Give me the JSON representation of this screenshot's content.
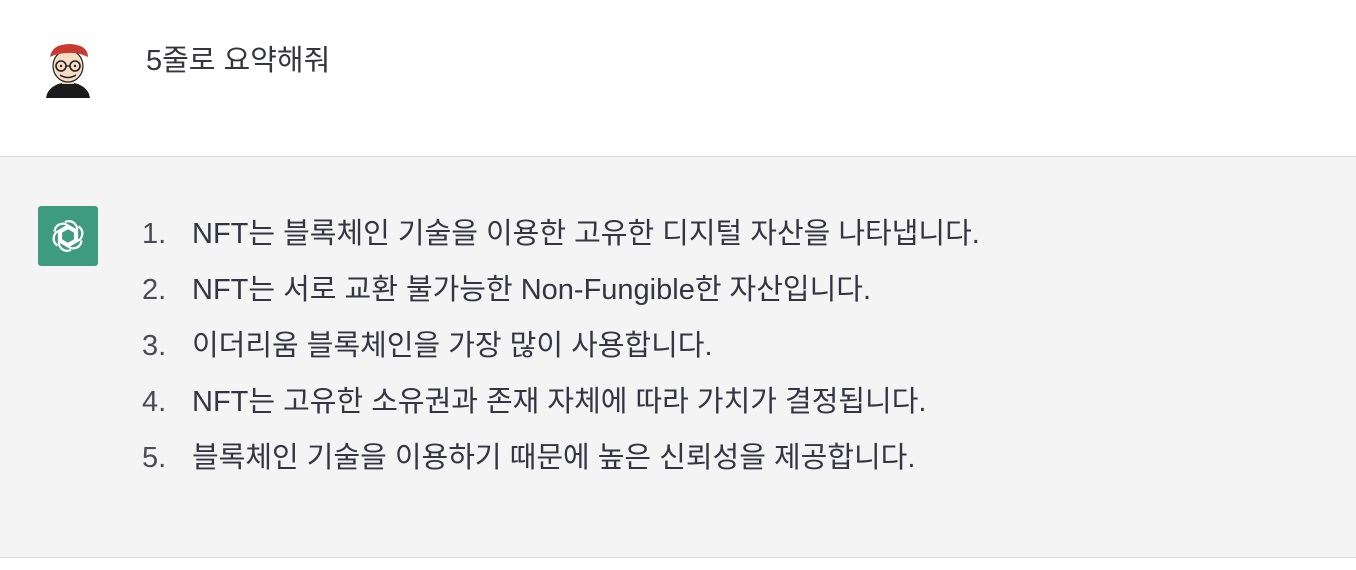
{
  "user_message": {
    "text": "5줄로 요약해줘",
    "avatar": "user-avatar-cartoon"
  },
  "assistant_message": {
    "icon": "openai-logo-icon",
    "icon_color": "#3f9b7e",
    "items": [
      {
        "num": "1.",
        "text": "NFT는 블록체인 기술을 이용한 고유한 디지털 자산을 나타냅니다."
      },
      {
        "num": "2.",
        "text": "NFT는 서로 교환 불가능한 Non-Fungible한 자산입니다."
      },
      {
        "num": "3.",
        "text": "이더리움 블록체인을 가장 많이 사용합니다."
      },
      {
        "num": "4.",
        "text": "NFT는 고유한 소유권과 존재 자체에 따라 가치가 결정됩니다."
      },
      {
        "num": "5.",
        "text": "블록체인 기술을 이용하기 때문에 높은 신뢰성을 제공합니다."
      }
    ]
  }
}
